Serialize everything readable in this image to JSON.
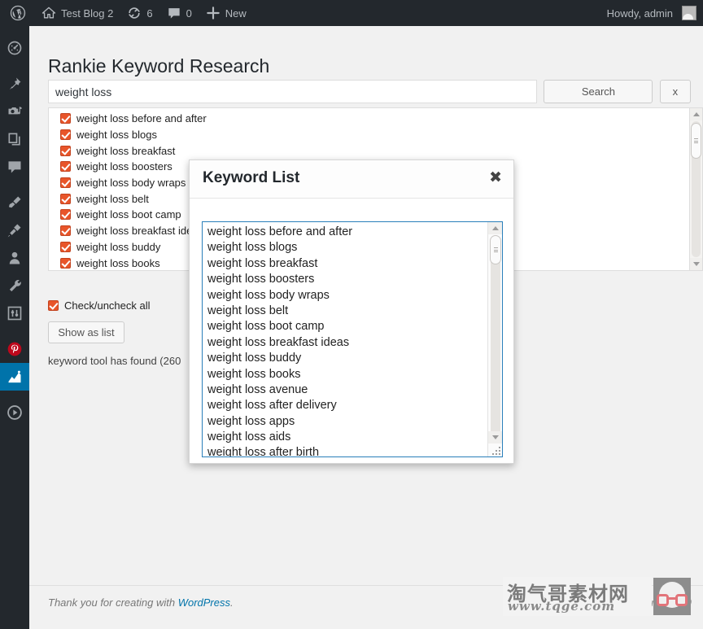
{
  "adminbar": {
    "wp_logo_icon": "wordpress-logo-icon",
    "site_icon": "home-icon",
    "site_name": "Test Blog 2",
    "updates_icon": "updates-refresh-icon",
    "updates_count": "6",
    "comments_icon": "comment-bubble-icon",
    "comments_count": "0",
    "new_icon": "plus-icon",
    "new_label": "New",
    "howdy": "Howdy, admin",
    "avatar_icon": "user-avatar-icon"
  },
  "sidebar": {
    "items": [
      {
        "name": "dashboard",
        "icon": "gauge-dashboard-icon",
        "active": false
      },
      {
        "name": "posts",
        "icon": "pushpin-icon",
        "active": false
      },
      {
        "name": "media",
        "icon": "media-camera-music-icon",
        "active": false
      },
      {
        "name": "pages",
        "icon": "pages-stack-icon",
        "active": false
      },
      {
        "name": "comments",
        "icon": "comment-bubble-icon",
        "active": false
      },
      {
        "name": "appearance",
        "icon": "paint-brush-icon",
        "active": false
      },
      {
        "name": "plugins",
        "icon": "plug-icon",
        "active": false
      },
      {
        "name": "users",
        "icon": "user-silhouette-icon",
        "active": false
      },
      {
        "name": "tools",
        "icon": "wrench-icon",
        "active": false
      },
      {
        "name": "settings",
        "icon": "sliders-settings-icon",
        "active": false
      },
      {
        "name": "pinterest",
        "icon": "pinterest-icon",
        "active": false
      },
      {
        "name": "rankie",
        "icon": "chart-rankie-icon",
        "active": true
      },
      {
        "name": "media-player",
        "icon": "play-circle-icon",
        "active": false
      }
    ]
  },
  "page": {
    "title": "Rankie Keyword Research"
  },
  "search": {
    "value": "weight loss",
    "placeholder": "",
    "search_label": "Search",
    "clear_label": "x"
  },
  "keyword_list": {
    "items": [
      "weight loss before and after",
      "weight loss blogs",
      "weight loss breakfast",
      "weight loss boosters",
      "weight loss body wraps",
      "weight loss belt",
      "weight loss boot camp",
      "weight loss breakfast ideas",
      "weight loss buddy",
      "weight loss books"
    ],
    "all_checked": true,
    "scrollbar_up_icon": "scroll-up-arrow-icon",
    "scrollbar_down_icon": "scroll-down-arrow-icon"
  },
  "controls": {
    "check_all_label": "Check/uncheck all",
    "check_all_checked": true,
    "show_as_list_label": "Show as list",
    "found_text": "keyword tool has found (260"
  },
  "modal": {
    "title": "Keyword List",
    "close_icon": "close-x-icon",
    "textarea_lines": [
      "weight loss before and after",
      "weight loss blogs",
      "weight loss breakfast",
      "weight loss boosters",
      "weight loss body wraps",
      "weight loss belt",
      "weight loss boot camp",
      "weight loss breakfast ideas",
      "weight loss buddy",
      "weight loss books",
      "weight loss avenue",
      "weight loss after delivery",
      "weight loss apps",
      "weight loss aids",
      "weight loss after birth"
    ],
    "scrollbar_up_icon": "scroll-up-arrow-icon",
    "scrollbar_down_icon": "scroll-down-arrow-icon",
    "resize_icon": "resize-grip-icon"
  },
  "footer": {
    "thanks_text": "Thank you for creating with ",
    "wordpress_link": "WordPress",
    "period": ".",
    "version": "Version 3.9"
  },
  "watermark": {
    "cn_text": "淘气哥素材网",
    "url_text": "www.tqge.com",
    "logo_icon": "glasses-face-logo-icon"
  },
  "colors": {
    "admin_dark": "#23282d",
    "accent_blue": "#0073aa",
    "checkbox_orange": "#e8552a",
    "link_blue": "#0073aa",
    "focus_border": "#2a7fba"
  }
}
